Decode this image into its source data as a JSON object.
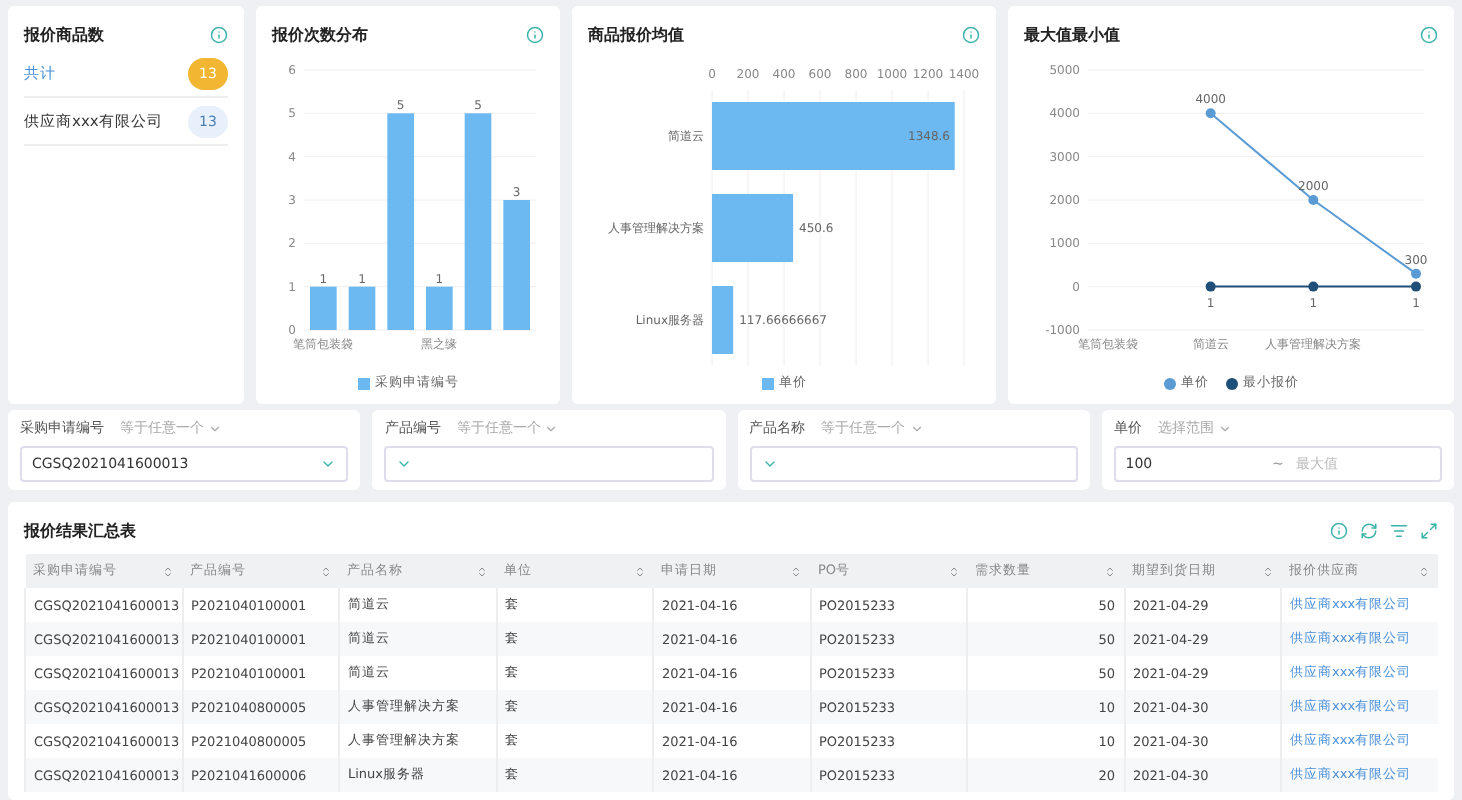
{
  "summary_card": {
    "title": "报价商品数",
    "items": [
      {
        "label": "共计",
        "count": "13",
        "selected": true
      },
      {
        "label": "供应商xxx有限公司",
        "count": "13",
        "selected": false
      }
    ]
  },
  "charts": [
    {
      "title": "报价次数分布",
      "chart_data": {
        "type": "bar",
        "orientation": "vertical",
        "grid": true,
        "categories": [
          "笔筒包装袋",
          null,
          null,
          "黑之缘",
          null,
          null
        ],
        "ylim": [
          0,
          6
        ],
        "yticks": [
          0,
          1,
          2,
          3,
          4,
          5,
          6
        ],
        "data_labels": true,
        "series": [
          {
            "name": "采购申请编号",
            "color": "#6cb8f0",
            "values": [
              1,
              1,
              5,
              1,
              5,
              3
            ]
          }
        ]
      }
    },
    {
      "title": "商品报价均值",
      "chart_data": {
        "type": "bar",
        "orientation": "horizontal",
        "grid": true,
        "categories": [
          "简道云",
          "人事管理解决方案",
          "Linux服务器"
        ],
        "xlim": [
          0,
          1400
        ],
        "xticks": [
          0,
          200,
          400,
          600,
          800,
          1000,
          1200,
          1400
        ],
        "data_labels": true,
        "value_labels": [
          "1348.6",
          "450.6",
          "117.66666667"
        ],
        "series": [
          {
            "name": "单价",
            "color": "#6cb8f0",
            "values": [
              1348.6,
              450.6,
              117.66666667
            ]
          }
        ]
      }
    },
    {
      "title": "最大值最小值",
      "chart_data": {
        "type": "line",
        "grid": true,
        "categories": [
          "笔筒包装袋",
          "简道云",
          "人事管理解决方案",
          null
        ],
        "ylim": [
          -1000,
          5000
        ],
        "yticks": [
          -1000,
          0,
          1000,
          2000,
          3000,
          4000,
          5000
        ],
        "data_labels": true,
        "series": [
          {
            "name": "单价",
            "color": "#5b9bd5",
            "marker": "circle",
            "values": [
              null,
              4000,
              2000,
              300
            ]
          },
          {
            "name": "最小报价",
            "color": "#1f4e79",
            "marker": "circle",
            "values": [
              null,
              1,
              1,
              1
            ]
          }
        ]
      }
    }
  ],
  "filters": [
    {
      "label": "采购申请编号",
      "operator": "等于任意一个",
      "kind": "select",
      "value": "CGSQ2021041600013"
    },
    {
      "label": "产品编号",
      "operator": "等于任意一个",
      "kind": "select"
    },
    {
      "label": "产品名称",
      "operator": "等于任意一个",
      "kind": "select"
    },
    {
      "label": "单价",
      "operator": "选择范围",
      "kind": "range",
      "value": "100",
      "separator": "~",
      "placeholder": "最大值"
    }
  ],
  "table": {
    "title": "报价结果汇总表",
    "columns": [
      "采购申请编号",
      "产品编号",
      "产品名称",
      "单位",
      "申请日期",
      "PO号",
      "需求数量",
      "期望到货日期",
      "报价供应商"
    ],
    "rows": [
      [
        "CGSQ2021041600013",
        "P2021040100001",
        "简道云",
        "套",
        "2021-04-16",
        "PO2015233",
        "50",
        "2021-04-29",
        "供应商xxx有限公司"
      ],
      [
        "CGSQ2021041600013",
        "P2021040100001",
        "简道云",
        "套",
        "2021-04-16",
        "PO2015233",
        "50",
        "2021-04-29",
        "供应商xxx有限公司"
      ],
      [
        "CGSQ2021041600013",
        "P2021040100001",
        "简道云",
        "套",
        "2021-04-16",
        "PO2015233",
        "50",
        "2021-04-29",
        "供应商xxx有限公司"
      ],
      [
        "CGSQ2021041600013",
        "P2021040800005",
        "人事管理解决方案",
        "套",
        "2021-04-16",
        "PO2015233",
        "10",
        "2021-04-30",
        "供应商xxx有限公司"
      ],
      [
        "CGSQ2021041600013",
        "P2021040800005",
        "人事管理解决方案",
        "套",
        "2021-04-16",
        "PO2015233",
        "10",
        "2021-04-30",
        "供应商xxx有限公司"
      ],
      [
        "CGSQ2021041600013",
        "P2021041600006",
        "Linux服务器",
        "套",
        "2021-04-16",
        "PO2015233",
        "20",
        "2021-04-30",
        "供应商xxx有限公司"
      ]
    ]
  }
}
